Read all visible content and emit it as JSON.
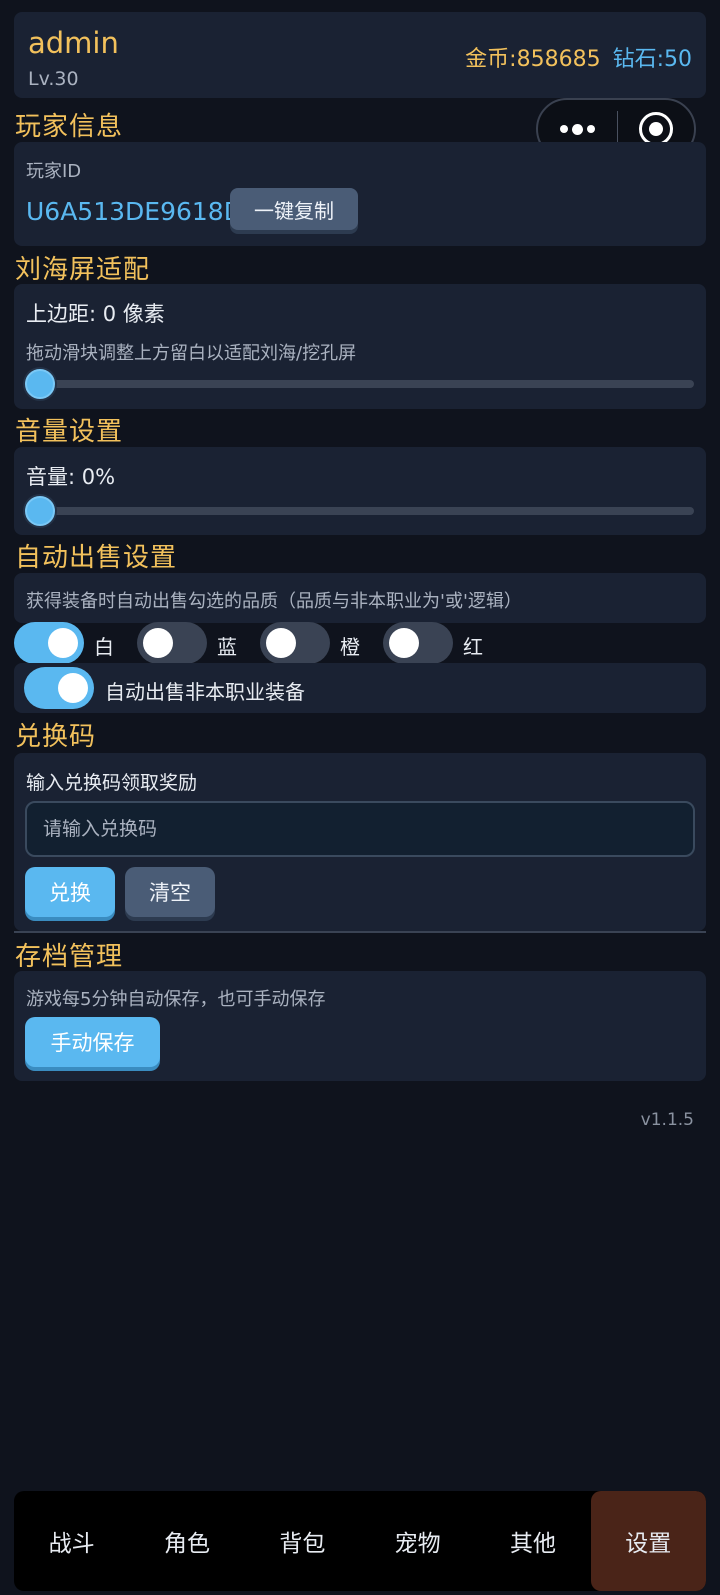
{
  "header": {
    "username": "admin",
    "level": "Lv.30",
    "gold": "金币:858685",
    "diamond": "钻石:50"
  },
  "sections": {
    "player_info": "玩家信息",
    "notch": "刘海屏适配",
    "volume": "音量设置",
    "auto_sell": "自动出售设置",
    "redeem": "兑换码",
    "save": "存档管理"
  },
  "player": {
    "id_label": "玩家ID",
    "id_value": "U6A513DE9618D",
    "copy_button": "一键复制"
  },
  "notch": {
    "margin_label": "上边距: 0 像素",
    "hint": "拖动滑块调整上方留白以适配刘海/挖孔屏",
    "value": 0
  },
  "volume": {
    "label": "音量: 0%",
    "value": 0
  },
  "auto_sell": {
    "hint": "获得装备时自动出售勾选的品质（品质与非本职业为'或'逻辑）",
    "qualities": [
      {
        "label": "白",
        "on": true
      },
      {
        "label": "蓝",
        "on": false
      },
      {
        "label": "橙",
        "on": false
      },
      {
        "label": "红",
        "on": false
      }
    ],
    "non_class_label": "自动出售非本职业装备",
    "non_class_on": true
  },
  "redeem": {
    "hint": "输入兑换码领取奖励",
    "placeholder": "请输入兑换码",
    "redeem_button": "兑换",
    "clear_button": "清空"
  },
  "save": {
    "hint": "游戏每5分钟自动保存，也可手动保存",
    "manual_button": "手动保存"
  },
  "version": "v1.1.5",
  "tabs": [
    {
      "label": "战斗"
    },
    {
      "label": "角色"
    },
    {
      "label": "背包"
    },
    {
      "label": "宠物"
    },
    {
      "label": "其他"
    },
    {
      "label": "设置",
      "active": true
    }
  ],
  "colors": {
    "accent_gold": "#f2c15c",
    "accent_blue": "#5ab8f0",
    "card_bg": "#1a2233",
    "page_bg": "#0f131d",
    "active_tab": "#4a2418"
  }
}
